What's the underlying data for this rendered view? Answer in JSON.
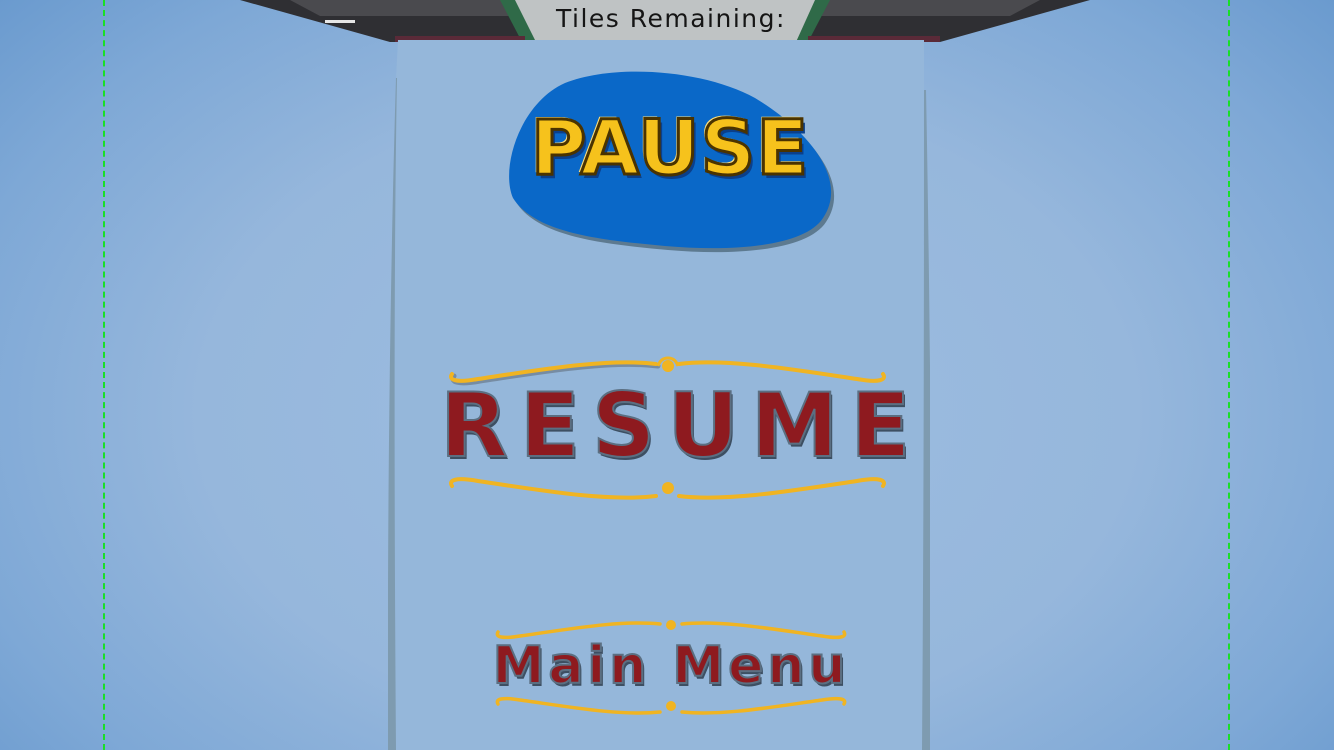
{
  "hud": {
    "tiles_label": "Tiles Remaining:"
  },
  "pause_panel": {
    "title": "PAUSE",
    "resume_label": "RESUME",
    "main_menu_label": "Main Menu"
  },
  "colors": {
    "background": "#96b7dc",
    "panel": "#95b7da",
    "title_blob": "#0a68c8",
    "title_text": "#f6c21c",
    "button_text": "#8e1a1f",
    "ornament": "#f0b422",
    "guide_line": "#19e026"
  }
}
